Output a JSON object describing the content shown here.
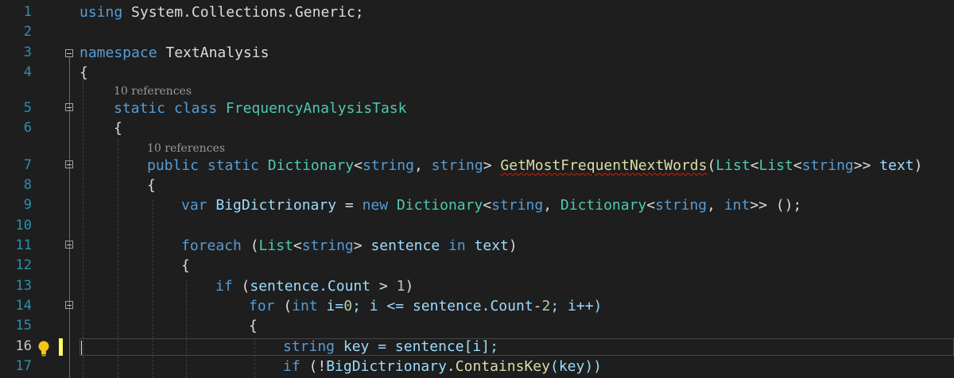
{
  "editor": {
    "colors": {
      "background": "#1e1e1e",
      "keyword": "#569cd6",
      "type": "#4ec9b0",
      "method": "#dcdcaa",
      "identifier": "#9cdcfe",
      "number": "#b5cea8",
      "line_number": "#2b91af",
      "error_squiggle": "#e51400"
    },
    "current_line": 16,
    "codelens": {
      "class_refs": "10 references",
      "method_refs": "10 references"
    },
    "line_numbers": [
      "1",
      "2",
      "3",
      "4",
      "5",
      "6",
      "7",
      "8",
      "9",
      "10",
      "11",
      "12",
      "13",
      "14",
      "15",
      "16",
      "17"
    ],
    "tokens": {
      "using": "using",
      "using_ns": "System.Collections.Generic;",
      "namespace_kw": "namespace",
      "namespace_name": " TextAnalysis",
      "brace_open": "{",
      "static": "static",
      "class": " class ",
      "class_name": "FrequencyAnalysisTask",
      "public": "public",
      "static2": " static ",
      "dictionary": "Dictionary",
      "lt": "<",
      "string": "string",
      "comma_sp": ", ",
      "gt_sp": "> ",
      "method_name": "GetMostFrequentNextWords",
      "paren_open": "(",
      "list": "List",
      "gtgt_sp": ">> ",
      "text_param": "text",
      "paren_close": ")",
      "var": "var",
      "big_dict": " BigDictrionary ",
      "eq_sp": "= ",
      "new": "new",
      "sp": " ",
      "int": "int",
      "gtgt_call": ">> ();",
      "foreach": "foreach",
      "sp_paren": " (",
      "gt_sp2": "> ",
      "sentence": "sentence",
      "in": " in ",
      "text": "text",
      "close_paren": ")",
      "if": "if",
      "sentence_count": "sentence.Count",
      "gt_one": " > ",
      "one": "1",
      "for": "for",
      "i_eq": " i=",
      "zero": "0",
      "semi_i_le": "; i <= ",
      "count_minus": "-",
      "two": "2",
      "semi_ipp": "; i++)",
      "key_decl": " key = sentence[i];",
      "if_not": " (!",
      "big_dict2": "BigDictrionary",
      "dot": ".",
      "contains_key": "ContainsKey",
      "key_call": "(key))"
    }
  }
}
